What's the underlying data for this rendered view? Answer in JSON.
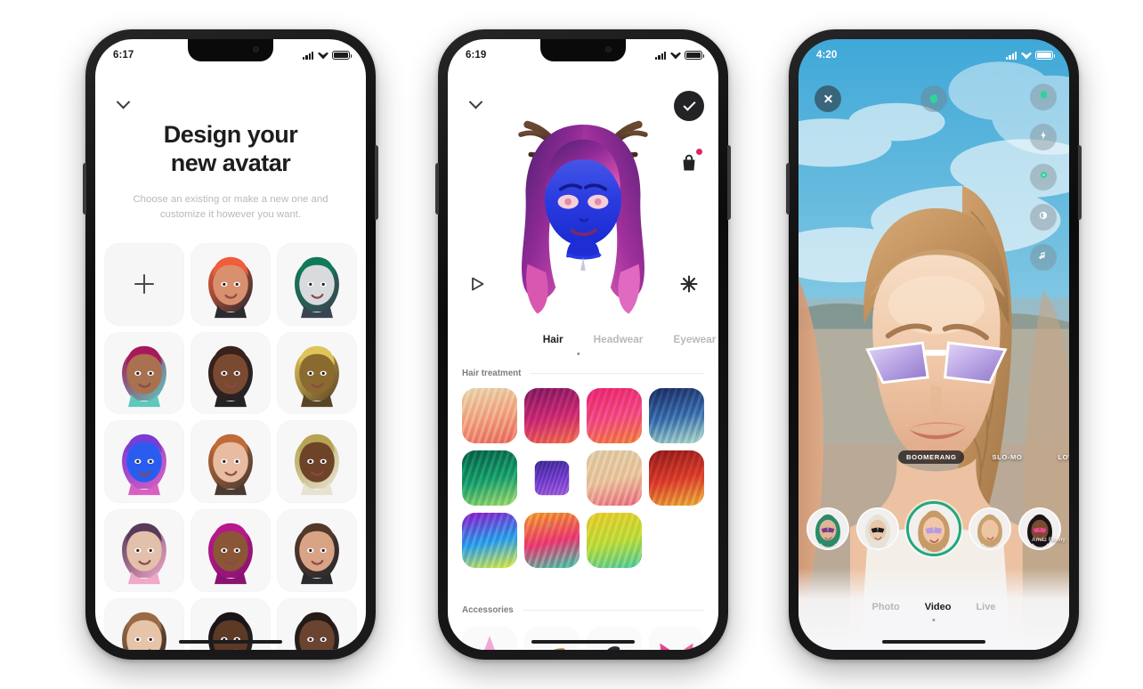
{
  "page": {
    "background": "#ffffff"
  },
  "phone1": {
    "name": "avatar-picker-screen",
    "status": {
      "time": "6:17",
      "signal_icon": "cellular-signal-icon",
      "wifi_icon": "wifi-icon",
      "battery_icon": "battery-full-icon"
    },
    "back_icon": "chevron-down-icon",
    "title_line1": "Design your",
    "title_line2": "new avatar",
    "subtitle": "Choose an existing or make a new one and customize it however you want.",
    "add_label": "+",
    "add_icon": "plus-icon",
    "avatars": [
      {
        "name": "add-new-avatar",
        "kind": "add"
      },
      {
        "name": "avatar-red-hair-cap",
        "kind": "av",
        "skin": "#d9906e",
        "hair": "#ef5d3c",
        "accent": "#2b2b30"
      },
      {
        "name": "avatar-green-mohawk-skull",
        "kind": "av",
        "skin": "#d8dadd",
        "hair": "#0f7a58",
        "accent": "#3a4450"
      },
      {
        "name": "avatar-magenta-braids",
        "kind": "av",
        "skin": "#a9714f",
        "hair": "#a8195a",
        "accent": "#5ec8bc"
      },
      {
        "name": "avatar-dark-curls",
        "kind": "av",
        "skin": "#7a4a30",
        "hair": "#3a211a",
        "accent": "#232326"
      },
      {
        "name": "avatar-gold-fauxhawk",
        "kind": "av",
        "skin": "#8a6a2e",
        "hair": "#e0c45a",
        "accent": "#5a4426"
      },
      {
        "name": "avatar-blue-creature",
        "kind": "av",
        "skin": "#2a5cf0",
        "hair": "#7a3cd6",
        "accent": "#d860c0"
      },
      {
        "name": "avatar-glasses-ginger",
        "kind": "av",
        "skin": "#e8bca0",
        "hair": "#c06a38",
        "accent": "#4a3a32"
      },
      {
        "name": "avatar-blonde-locs",
        "kind": "av",
        "skin": "#6e4428",
        "hair": "#b6a452",
        "accent": "#e8e2d2"
      },
      {
        "name": "avatar-visor-pink",
        "kind": "av",
        "skin": "#e2c0ac",
        "hair": "#5a3a58",
        "accent": "#f0a8c8"
      },
      {
        "name": "avatar-magenta-hijab",
        "kind": "av",
        "skin": "#8a5636",
        "hair": "#b8188c",
        "accent": "#8a1270"
      },
      {
        "name": "avatar-short-crop-red-lip",
        "kind": "av",
        "skin": "#d9a386",
        "hair": "#54382a",
        "accent": "#2a2a2e"
      },
      {
        "name": "avatar-light-brown-bob",
        "kind": "av",
        "skin": "#e6c4a8",
        "hair": "#9a6a44",
        "accent": "#3a2a22"
      },
      {
        "name": "avatar-dark-straight-bangs",
        "kind": "av",
        "skin": "#5c3a26",
        "hair": "#1a1418",
        "accent": "#242428"
      },
      {
        "name": "avatar-afro-puff",
        "kind": "av",
        "skin": "#6a4430",
        "hair": "#241a16",
        "accent": "#2a2226"
      }
    ]
  },
  "phone2": {
    "name": "avatar-customizer-screen",
    "status": {
      "time": "6:19",
      "signal_icon": "cellular-signal-icon",
      "wifi_icon": "wifi-icon",
      "battery_icon": "battery-full-icon"
    },
    "back_icon": "chevron-down-icon",
    "confirm_icon": "checkmark-icon",
    "shop_icon": "shopping-bag-icon",
    "shop_badge": true,
    "animate_icon": "play-outline-icon",
    "effects_icon": "sparkle-icon",
    "preview_name": "avatar-preview-blue-antlers",
    "tabs": [
      {
        "label": "Hair",
        "active": true
      },
      {
        "label": "Headwear",
        "active": false
      },
      {
        "label": "Eyewear",
        "active": false
      }
    ],
    "sections": [
      {
        "label": "Hair treatment"
      },
      {
        "label": "Accessories"
      }
    ],
    "swatches": [
      {
        "name": "swatch-blonde-coral",
        "from": "#e8d4a8",
        "mid": "#f0a07c",
        "to": "#e8685e",
        "selected": false
      },
      {
        "name": "swatch-magenta-sunset",
        "from": "#7a1a5c",
        "mid": "#c8286e",
        "to": "#f06a48",
        "selected": false
      },
      {
        "name": "swatch-pink-orange",
        "from": "#e8246c",
        "mid": "#f0487c",
        "to": "#f07a3a",
        "selected": false
      },
      {
        "name": "swatch-navy-teal",
        "from": "#1a2a5c",
        "mid": "#3a6aa8",
        "to": "#a8d8c8",
        "selected": false
      },
      {
        "name": "swatch-emerald-lime",
        "from": "#0a5c48",
        "mid": "#1a9a68",
        "to": "#9ad868",
        "selected": false
      },
      {
        "name": "swatch-violet-purple",
        "from": "#3a2a8c",
        "mid": "#6a3ac8",
        "to": "#9a5ad8",
        "selected": true
      },
      {
        "name": "swatch-sand-rose",
        "from": "#dcc8a0",
        "mid": "#e8c098",
        "to": "#e8687c",
        "selected": false
      },
      {
        "name": "swatch-crimson-gold",
        "from": "#8c1a1a",
        "mid": "#d83a2a",
        "to": "#e8a83a",
        "selected": false
      },
      {
        "name": "swatch-rainbow-magenta",
        "from": "#8a1ac8",
        "mid": "#2a9ae8",
        "to": "#d8e838",
        "selected": false
      },
      {
        "name": "swatch-rainbow-warm",
        "from": "#f0982a",
        "mid": "#e8386c",
        "to": "#38c8a8",
        "selected": false
      },
      {
        "name": "swatch-yellow-green",
        "from": "#e8c82a",
        "mid": "#b8d838",
        "to": "#4ac898",
        "selected": false
      }
    ],
    "accessories": [
      {
        "name": "accessory-pink-star-clip"
      },
      {
        "name": "accessory-gold-antlers"
      },
      {
        "name": "accessory-dark-headpiece"
      },
      {
        "name": "accessory-pink-bow"
      }
    ]
  },
  "phone3": {
    "name": "camera-ar-screen",
    "status": {
      "time": "4:20",
      "signal_icon": "cellular-signal-icon",
      "wifi_icon": "wifi-icon",
      "battery_icon": "battery-full-icon"
    },
    "close_icon": "close-x-icon",
    "top_center_icon": "avatar-sticker-icon",
    "rail": [
      {
        "name": "rail-button-avatar",
        "icon": "avatar-head-icon",
        "tint": "#2fd39a"
      },
      {
        "name": "rail-button-flash",
        "icon": "flash-icon",
        "tint": "#ffffff"
      },
      {
        "name": "rail-button-effects",
        "icon": "effects-icon",
        "tint": "#2fd39a"
      },
      {
        "name": "rail-button-filters",
        "icon": "contrast-icon",
        "tint": "#ffffff"
      },
      {
        "name": "rail-button-music",
        "icon": "music-note-icon",
        "tint": "#ffffff"
      }
    ],
    "chips": [
      {
        "label": "BOOMERANG",
        "active": true
      },
      {
        "label": "SLO-MO",
        "active": false
      },
      {
        "label": "LOW L",
        "active": false
      }
    ],
    "lenses": [
      {
        "name": "lens-green-hair",
        "active": false,
        "skin": "#e0b496",
        "hair": "#2a8a6a",
        "prop": "#7a3a8a"
      },
      {
        "name": "lens-white-hair-shades",
        "active": false,
        "skin": "#e8c8a8",
        "hair": "#e6e2d8",
        "prop": "#1a1a1e"
      },
      {
        "name": "lens-braid-sunglasses",
        "active": true,
        "skin": "#f0c8a8",
        "hair": "#c89a68",
        "prop": "#b89ae0"
      },
      {
        "name": "lens-long-blonde",
        "active": false,
        "skin": "#eec4a2",
        "hair": "#c8a070",
        "prop": "#e8c8a0"
      },
      {
        "name": "lens-dark-hair-pink-top",
        "active": false,
        "skin": "#7a4a32",
        "hair": "#1a1418",
        "prop": "#e84a8a"
      }
    ],
    "side_badge": "Amaz\nFunny",
    "modes": [
      {
        "label": "Photo",
        "active": false
      },
      {
        "label": "Video",
        "active": true
      },
      {
        "label": "Live",
        "active": false
      }
    ]
  }
}
